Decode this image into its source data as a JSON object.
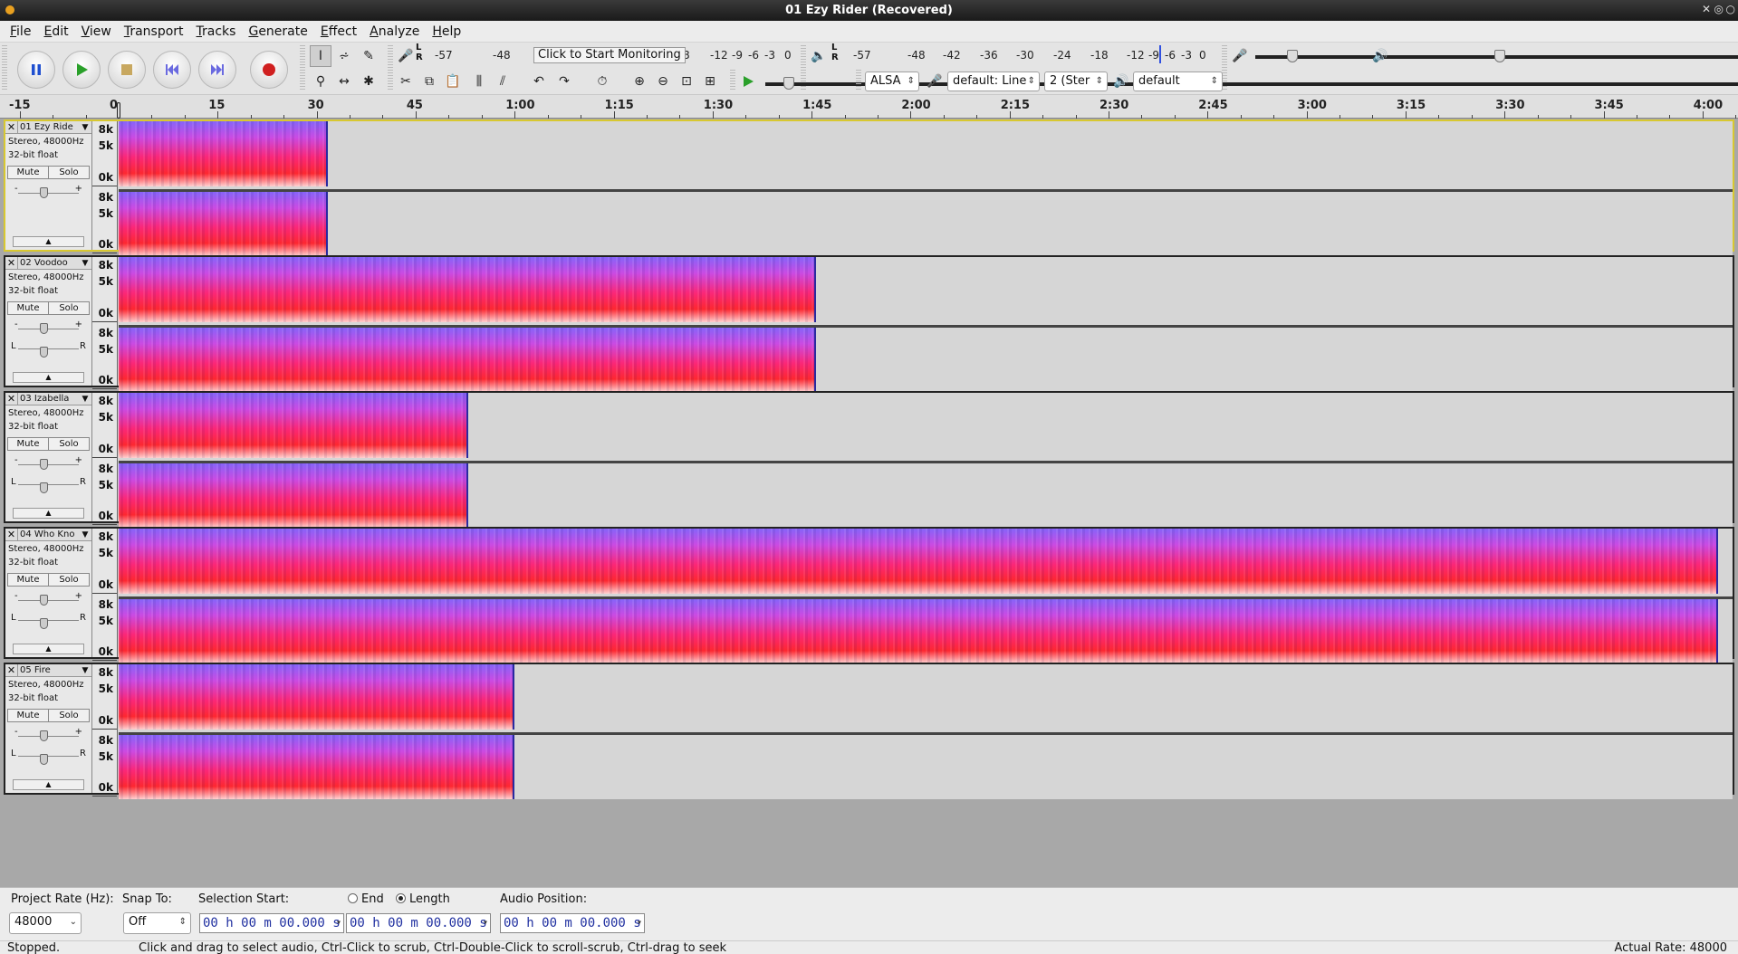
{
  "window": {
    "title": "01 Ezy Rider (Recovered)"
  },
  "menu": [
    {
      "label": "File"
    },
    {
      "label": "Edit"
    },
    {
      "label": "View"
    },
    {
      "label": "Transport"
    },
    {
      "label": "Tracks"
    },
    {
      "label": "Generate"
    },
    {
      "label": "Effect"
    },
    {
      "label": "Analyze"
    },
    {
      "label": "Help"
    }
  ],
  "transport": {
    "pause_icon": "pause-icon",
    "play_icon": "play-icon",
    "stop_icon": "stop-icon",
    "skip_start_icon": "skip-start-icon",
    "skip_end_icon": "skip-end-icon",
    "record_icon": "record-icon",
    "colors": {
      "play": "#2aa02a",
      "record": "#d02020",
      "pause": "#2050d0"
    }
  },
  "meters": {
    "record_ticks": [
      "-57",
      "-48"
    ],
    "record_tooltip": "Click to Start Monitoring",
    "record_ticks_right": [
      "8",
      "-12",
      "-9",
      "-6",
      "-3",
      "0"
    ],
    "playback_ticks": [
      "-57",
      "-48",
      "-42",
      "-36",
      "-30",
      "-24",
      "-18",
      "-12",
      "-9",
      "-6",
      "-3",
      "0"
    ],
    "lr_label_l": "L",
    "lr_label_r": "R"
  },
  "device": {
    "host": "ALSA",
    "record_device": "default: Line",
    "channels": "2 (Ster",
    "playback_device": "default"
  },
  "ruler": {
    "labels": [
      "-15",
      "0",
      "15",
      "30",
      "45",
      "1:00",
      "1:15",
      "1:30",
      "1:45",
      "2:00",
      "2:15",
      "2:30",
      "2:45",
      "3:00",
      "3:15",
      "3:30",
      "3:45",
      "4:00"
    ]
  },
  "tracks": [
    {
      "name": "01 Ezy Ride",
      "info1": "Stereo, 48000Hz",
      "info2": "32-bit float",
      "selected": true,
      "clip_fraction": 0.1292,
      "has_pan": false
    },
    {
      "name": "02 Voodoo",
      "info1": "Stereo, 48000Hz",
      "info2": "32-bit float",
      "selected": false,
      "clip_fraction": 0.4313,
      "has_pan": true
    },
    {
      "name": "03 Izabella",
      "info1": "Stereo, 48000Hz",
      "info2": "32-bit float",
      "selected": false,
      "clip_fraction": 0.216,
      "has_pan": true
    },
    {
      "name": "04 Who Kno",
      "info1": "Stereo, 48000Hz",
      "info2": "32-bit float",
      "selected": false,
      "clip_fraction": 0.989,
      "has_pan": true
    },
    {
      "name": "05 Fire",
      "info1": "Stereo, 48000Hz",
      "info2": "32-bit float",
      "selected": false,
      "clip_fraction": 0.2448,
      "has_pan": true
    }
  ],
  "track_labels": {
    "mute": "Mute",
    "solo": "Solo",
    "gain_minus": "-",
    "gain_plus": "+",
    "pan_l": "L",
    "pan_r": "R",
    "freq_top": "8k",
    "freq_mid": "5k",
    "freq_bot": "0k"
  },
  "selection_bar": {
    "project_rate_label": "Project Rate (Hz):",
    "project_rate_value": "48000",
    "snap_to_label": "Snap To:",
    "snap_to_value": "Off",
    "selection_start_label": "Selection Start:",
    "end_label": "End",
    "length_label": "Length",
    "audio_position_label": "Audio Position:",
    "selection_start_value": "00 h 00 m 00.000 s",
    "length_value": "00 h 00 m 00.000 s",
    "audio_position_value": "00 h 00 m 00.000 s"
  },
  "status": {
    "state": "Stopped.",
    "hint": "Click and drag to select audio, Ctrl-Click to scrub, Ctrl-Double-Click to scroll-scrub, Ctrl-drag to seek",
    "actual_rate": "Actual Rate: 48000"
  }
}
